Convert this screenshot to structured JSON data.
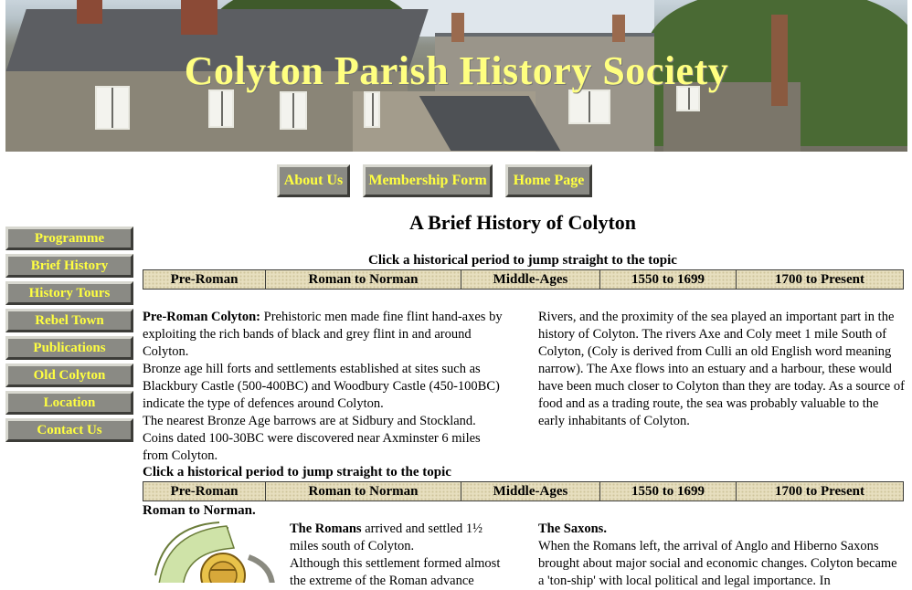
{
  "banner": {
    "title": "Colyton Parish History Society"
  },
  "top_nav": [
    {
      "label": "About Us"
    },
    {
      "label": "Membership Form"
    },
    {
      "label": "Home Page"
    }
  ],
  "side_nav": [
    {
      "label": "Programme"
    },
    {
      "label": "Brief History"
    },
    {
      "label": "History Tours"
    },
    {
      "label": "Rebel Town"
    },
    {
      "label": "Publications"
    },
    {
      "label": "Old Colyton"
    },
    {
      "label": "Location"
    },
    {
      "label": "Contact Us"
    }
  ],
  "main": {
    "title": "A Brief History of Colyton",
    "jump_label_1": "Click a historical period to jump straight to the topic",
    "jump_label_2": "Click a historical period to jump straight to the topic",
    "periods": [
      "Pre-Roman",
      "Roman to Norman",
      "Middle-Ages",
      "1550 to 1699",
      "1700 to Present"
    ],
    "preroman": {
      "heading": "Pre-Roman Colyton:",
      "p1": " Prehistoric men made fine flint hand-axes by exploiting the rich bands of black and grey flint in and around Colyton.",
      "p2": "Bronze age hill forts and settlements  established at sites such as Blackbury Castle (500-400BC) and Woodbury Castle (450-100BC) indicate the type of defences around Colyton.",
      "p3": "The nearest Bronze Age barrows are at Sidbury and Stockland. Coins dated 100-30BC were discovered near Axminster 6 miles from Colyton.",
      "right": "Rivers, and the proximity of the sea played an important part in the history of Colyton. The rivers Axe and Coly meet 1 mile South of Colyton, (Coly is derived from Culli an old English word meaning narrow). The Axe flows into an estuary and a harbour, these would have been much closer to Colyton than they are today.  As a source of food and as a trading route, the sea was probably valuable to the early inhabitants of Colyton."
    },
    "roman": {
      "heading": "Roman to Norman.",
      "romans_head": "The Romans",
      "romans_text": " arrived and settled 1½ miles south of Colyton.",
      "romans_text2": "Although this settlement formed almost the extreme of the Roman advance",
      "saxons_head": "The Saxons.",
      "saxons_text": "When the Romans left, the arrival of Anglo and Hiberno Saxons brought about major social and economic changes. Colyton became a 'ton-ship' with local political and legal importance. In"
    }
  },
  "colors": {
    "button_face": "#8a8a84",
    "button_text": "#ffff40",
    "banner_title": "#ffff80",
    "period_cell": "#e7dfbf"
  },
  "icons": {
    "helmet": "roman-helmet-icon"
  }
}
